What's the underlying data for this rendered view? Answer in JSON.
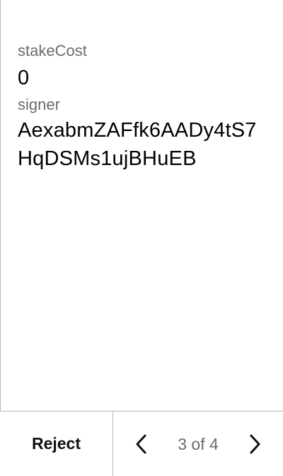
{
  "fields": [
    {
      "label": "stakeCost",
      "value": "0"
    },
    {
      "label": "signer",
      "value": "AexabmZAFfk6AADy4tS7HqDSMs1ujBHuEB"
    }
  ],
  "footer": {
    "reject_label": "Reject",
    "page_indicator": "3 of 4",
    "prev_icon": "chevron-left-icon",
    "next_icon": "chevron-right-icon"
  }
}
